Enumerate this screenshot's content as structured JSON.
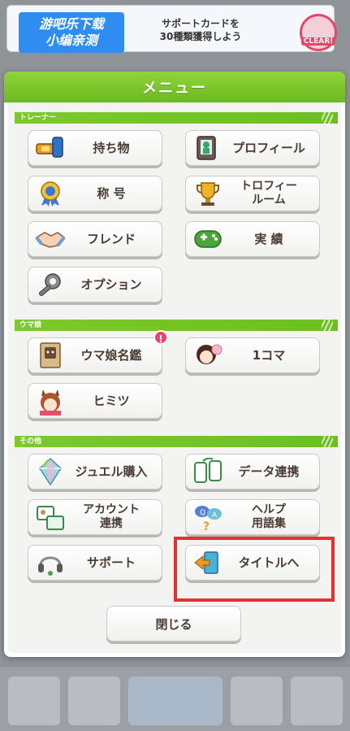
{
  "banner": {
    "watermark_line1": "游吧乐下载",
    "watermark_line2": "小编亲测",
    "text_line1": "サポートカードを",
    "text_line2": "30種類獲得しよう",
    "badge": "CLEAR!"
  },
  "menu": {
    "title": "メニュー",
    "sections": {
      "trainer": "トレーナー",
      "umamusume": "ウマ娘",
      "other": "その他"
    },
    "buttons": {
      "items": "持ち物",
      "profile": "プロフィール",
      "title": "称 号",
      "trophy_room_1": "トロフィー",
      "trophy_room_2": "ルーム",
      "friends": "フレンド",
      "achievements": "実 績",
      "options": "オプション",
      "uma_encyclopedia": "ウマ娘名鑑",
      "one_koma": "1コマ",
      "secret": "ヒミツ",
      "jewel_purchase": "ジュエル購入",
      "data_link": "データ連携",
      "account_link_1": "アカウント",
      "account_link_2": "連携",
      "help_1": "ヘルプ",
      "help_2": "用語集",
      "support": "サポート",
      "to_title": "タイトルへ"
    },
    "notice_mark": "!",
    "close": "閉じる"
  },
  "colors": {
    "header_green": "#7cc92e",
    "label_brown": "#4a3b33",
    "highlight_red": "#e23232",
    "notice_pink": "#e5476b"
  }
}
